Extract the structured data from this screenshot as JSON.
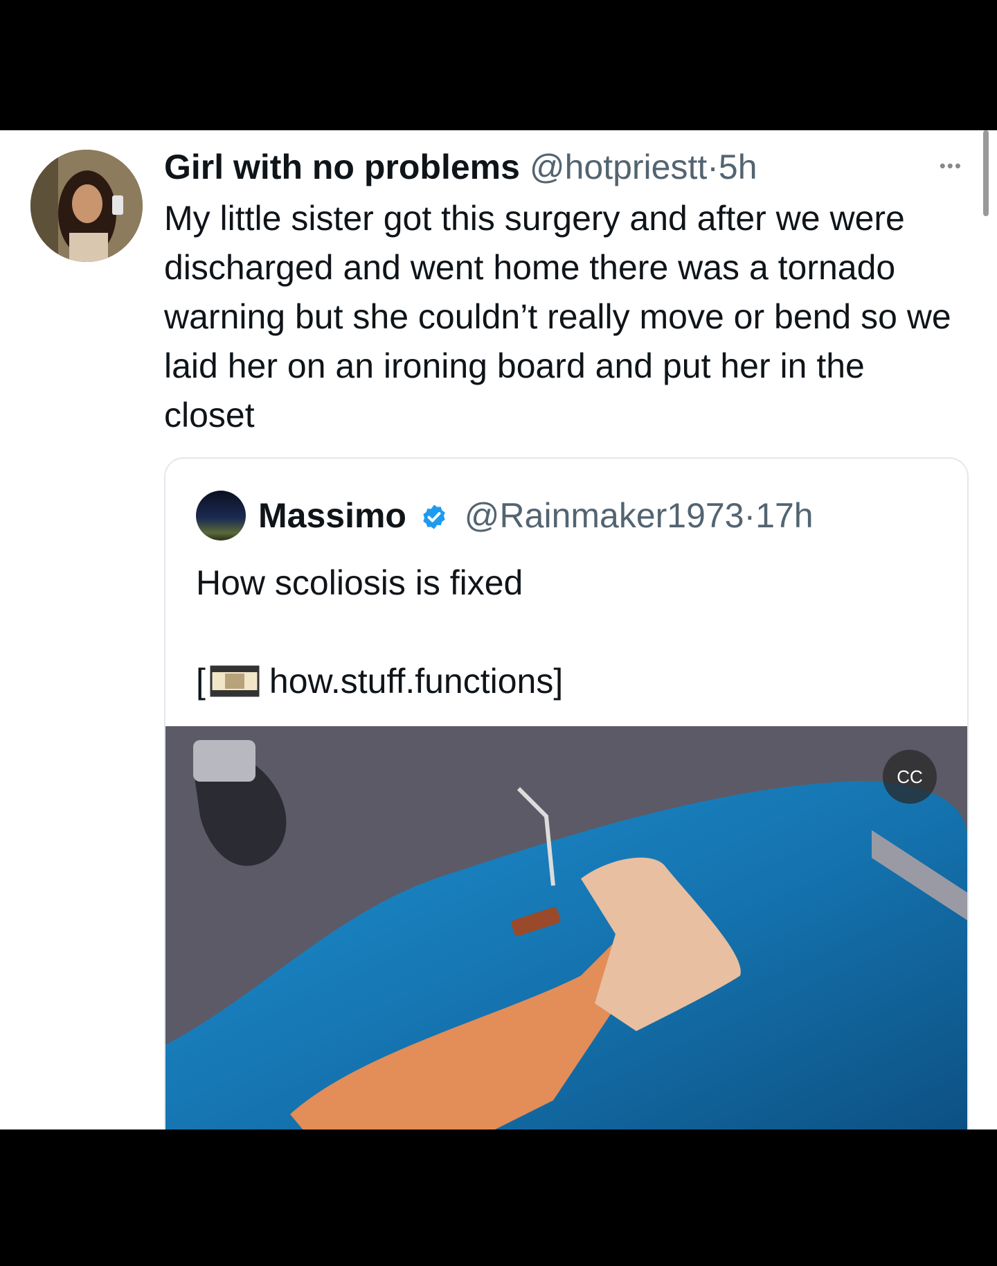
{
  "tweet": {
    "display_name": "Girl with no problems",
    "handle": "@hotpriestt",
    "separator": "·",
    "time": "5h",
    "text": "My little sister got this surgery and after we were discharged and went home there was a tornado warning but she couldn’t really move or bend so we laid her on an ironing board and put her in the closet",
    "more_label": "•••"
  },
  "quote": {
    "display_name": "Massimo",
    "handle": "@Rainmaker1973",
    "separator": "·",
    "time": "17h",
    "text": "How scoliosis is fixed",
    "link_open": "[",
    "link_text": "how.stuff.functions]",
    "cc_label": "CC"
  },
  "colors": {
    "text": "#0f1419",
    "secondary": "#536471",
    "verified": "#1d9bf0",
    "border": "#e1e8ed"
  },
  "icons": [
    "more-icon",
    "verified-badge-icon",
    "film-strip-icon",
    "captions-off-icon"
  ]
}
